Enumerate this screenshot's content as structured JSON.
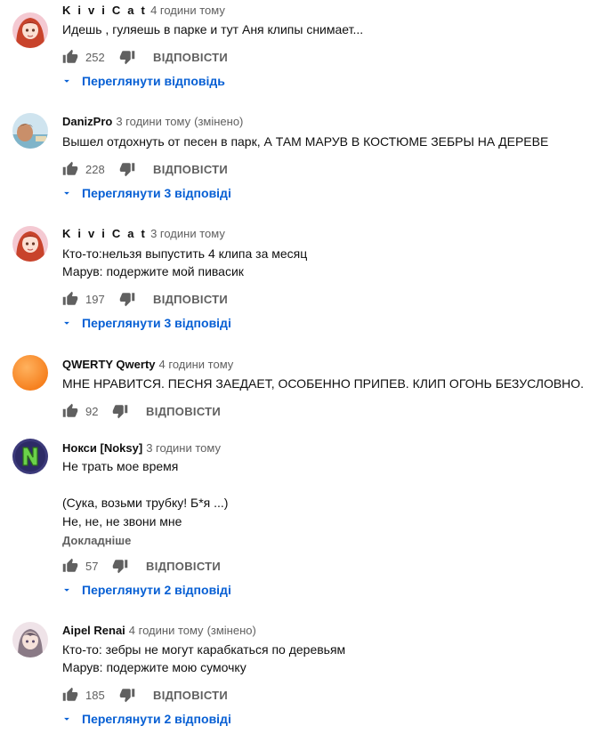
{
  "reply_label": "ВІДПОВІСТИ",
  "comments": [
    {
      "author": "K i v i C a t",
      "time": "4 години тому",
      "edited": "",
      "lines": [
        "Идешь , гуляешь в парке и тут Аня клипы снимает..."
      ],
      "more": "",
      "likes": "252",
      "replies": "Переглянути відповідь",
      "avatar_icon": "redhead-girl-avatar"
    },
    {
      "author": "DanizPro",
      "time": "3 години тому",
      "edited": "(змінено)",
      "lines": [
        "Вышел отдохнуть от песен в парк, А ТАМ МАРУВ В КОСТЮМЕ ЗЕБРЫ НА ДЕРЕВЕ"
      ],
      "more": "",
      "likes": "228",
      "replies": "Переглянути 3 відповіді",
      "avatar_icon": "person-photo-avatar"
    },
    {
      "author": "K i v i C a t",
      "time": "3 години тому",
      "edited": "",
      "lines": [
        "Кто-то:нельзя выпустить 4 клипа за месяц",
        "Марув: подержите мой пивасик"
      ],
      "more": "",
      "likes": "197",
      "replies": "Переглянути 3 відповіді",
      "avatar_icon": "redhead-girl-avatar"
    },
    {
      "author": "QWERTY Qwerty",
      "time": "4 години тому",
      "edited": "",
      "lines": [
        "МНЕ НРАВИТСЯ. ПЕСНЯ ЗАЕДАЕТ, ОСОБЕННО ПРИПЕВ. КЛИП ОГОНЬ БЕЗУСЛОВНО."
      ],
      "more": "",
      "likes": "92",
      "replies": "",
      "avatar_icon": "orange-circle-avatar"
    },
    {
      "author": "Нокси [Noksy]",
      "time": "3 години тому",
      "edited": "",
      "lines": [
        "Не трать мое время",
        "",
        "(Сука, возьми трубку! Б*я ...)",
        "Не, не, не звони мне"
      ],
      "more": "Докладніше",
      "likes": "57",
      "replies": "Переглянути 2 відповіді",
      "avatar_icon": "letter-n-avatar"
    },
    {
      "author": "Aipel Renai",
      "time": "4 години тому",
      "edited": "(змінено)",
      "lines": [
        "Кто-то: зебры не могут карабкаться по деревьям",
        "Марув: подержите мою сумочку"
      ],
      "more": "",
      "likes": "185",
      "replies": "Переглянути 2 відповіді",
      "avatar_icon": "anime-girl-avatar"
    }
  ]
}
